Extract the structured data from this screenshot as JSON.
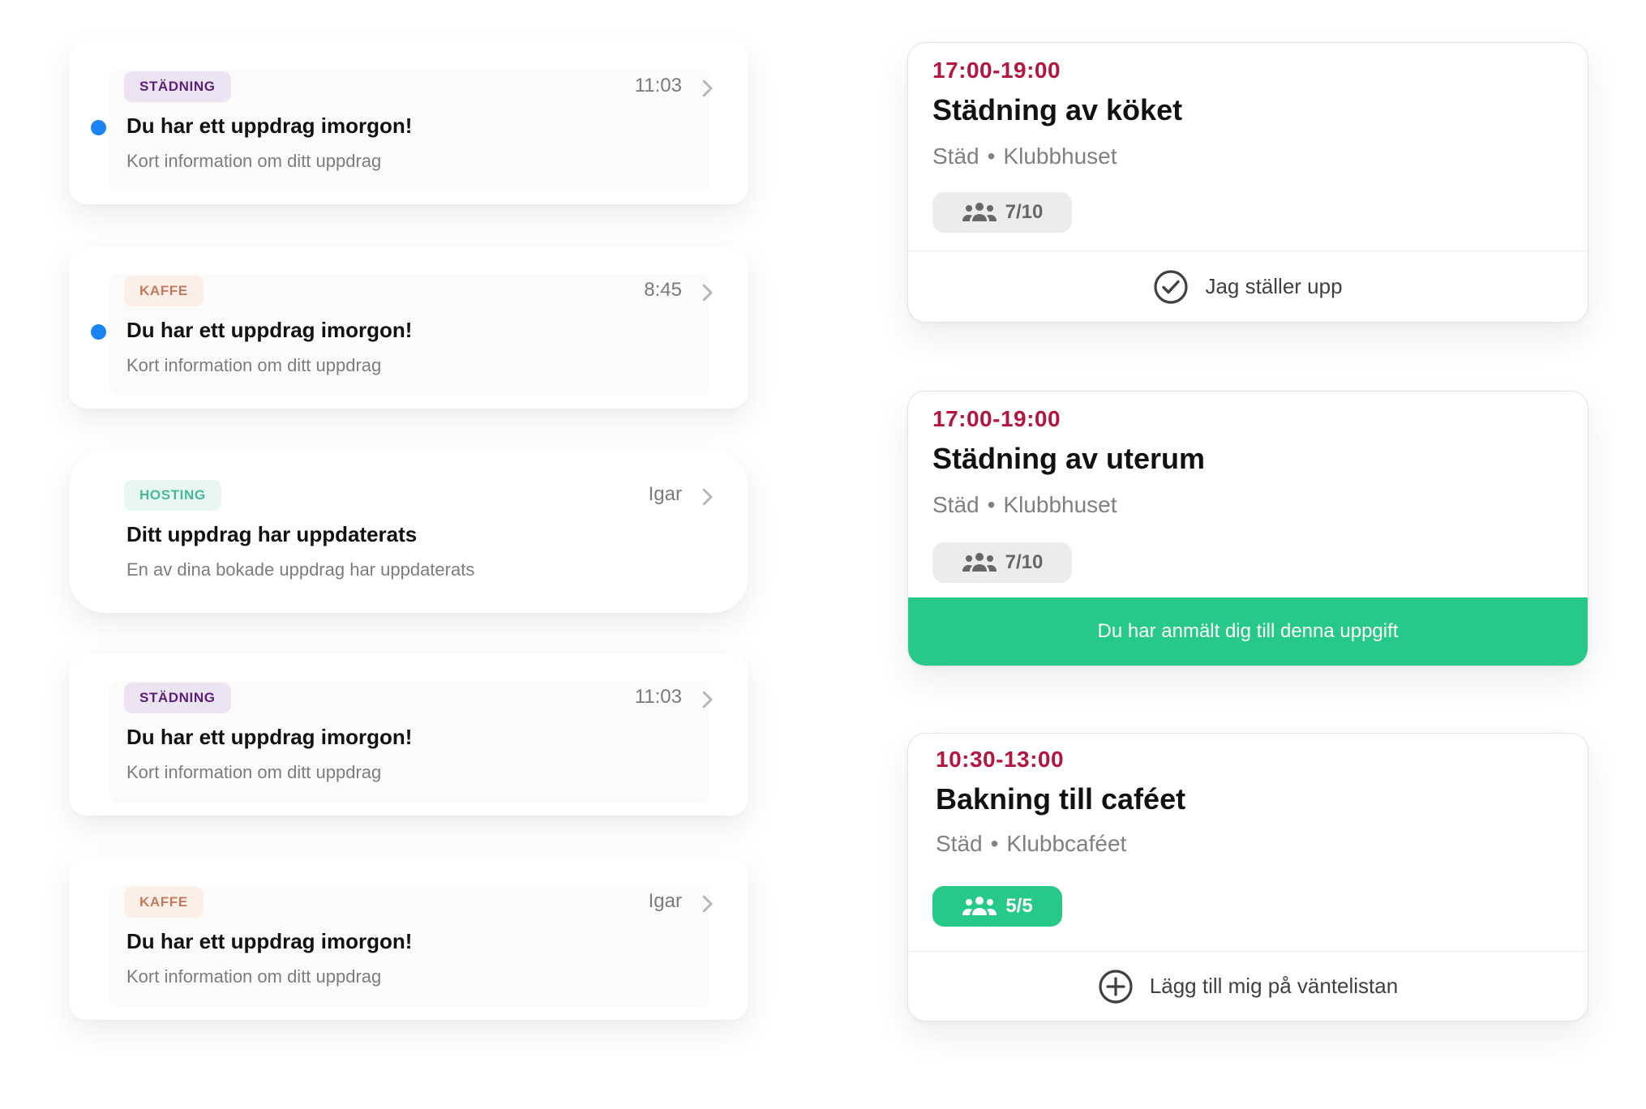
{
  "notifications": [
    {
      "tag": "STÄDNING",
      "time": "11:03",
      "title": "Du har ett uppdrag imorgon!",
      "subtitle": "Kort information om ditt uppdrag",
      "unread": true
    },
    {
      "tag": "KAFFE",
      "time": "8:45",
      "title": "Du har ett uppdrag imorgon!",
      "subtitle": "Kort information om ditt uppdrag",
      "unread": true
    },
    {
      "tag": "HOSTING",
      "time": "Igar",
      "title": "Ditt uppdrag har uppdaterats",
      "subtitle": "En av dina bokade uppdrag har uppdaterats",
      "unread": false
    },
    {
      "tag": "STÄDNING",
      "time": "11:03",
      "title": "Du har ett uppdrag imorgon!",
      "subtitle": "Kort information om ditt uppdrag",
      "unread": false
    },
    {
      "tag": "KAFFE",
      "time": "Igar",
      "title": "Du har ett uppdrag imorgon!",
      "subtitle": "Kort information om ditt uppdrag",
      "unread": false
    }
  ],
  "tasks": [
    {
      "time": "17:00-19:00",
      "title": "Städning av köket",
      "category": "Städ",
      "separator": "•",
      "location": "Klubbhuset",
      "capacity": "7/10",
      "action": "Jag ställer upp",
      "action_icon": "check-circle-icon"
    },
    {
      "time": "17:00-19:00",
      "title": "Städning av uterum",
      "category": "Städ",
      "separator": "•",
      "location": "Klubbhuset",
      "capacity": "7/10",
      "status": "Du har anmält dig till denna uppgift"
    },
    {
      "time": "10:30-13:00",
      "title": "Bakning till caféet",
      "category": "Städ",
      "separator": "•",
      "location": "Klubbcaféet",
      "capacity": "5/5",
      "action": "Lägg till mig på väntelistan",
      "action_icon": "plus-circle-icon"
    }
  ],
  "colors": {
    "time_red": "#b3163f",
    "green": "#26c987",
    "unread_blue": "#1a84f5",
    "tag_stadning": "#5a1f78",
    "tag_kaffe": "#c27a5f",
    "tag_hosting": "#47b99a"
  }
}
